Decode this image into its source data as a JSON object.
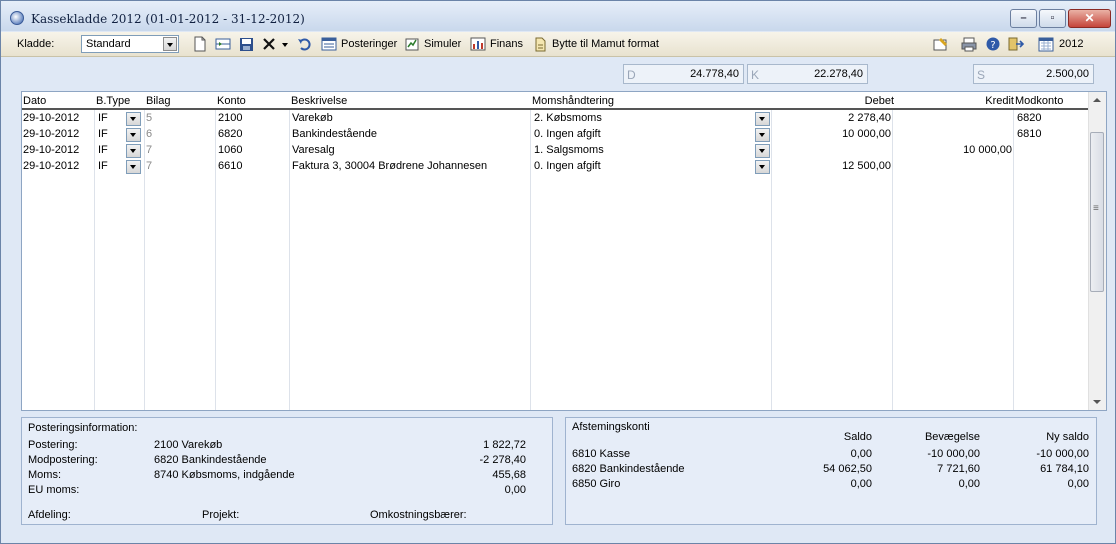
{
  "window": {
    "title": "Kassekladde 2012 (01-01-2012 - 31-12-2012)",
    "minimize": "–",
    "maximize": "▫",
    "close": "✕"
  },
  "toolbar": {
    "kladde_label": "Kladde:",
    "kladde_value": "Standard",
    "posteringer": "Posteringer",
    "simuler": "Simuler",
    "finans": "Finans",
    "bytte": "Bytte til Mamut format",
    "year": "2012"
  },
  "totals": {
    "d_prefix": "D",
    "d_value": "24.778,40",
    "k_prefix": "K",
    "k_value": "22.278,40",
    "s_prefix": "S",
    "s_value": "2.500,00"
  },
  "grid": {
    "columns": [
      "Dato",
      "B.Type",
      "Bilag",
      "Konto",
      "Beskrivelse",
      "Momshåndtering",
      "Debet",
      "Kredit",
      "Modkonto"
    ],
    "rows": [
      {
        "dato": "29-10-2012",
        "btype": "IF",
        "bilag": "5",
        "konto": "2100",
        "beskrivelse": "Varekøb",
        "moms": "2. Købsmoms",
        "debet": "2 278,40",
        "kredit": "",
        "modkonto": "6820"
      },
      {
        "dato": "29-10-2012",
        "btype": "IF",
        "bilag": "6",
        "konto": "6820",
        "beskrivelse": "Bankindestående",
        "moms": "0. Ingen afgift",
        "debet": "10 000,00",
        "kredit": "",
        "modkonto": "6810"
      },
      {
        "dato": "29-10-2012",
        "btype": "IF",
        "bilag": "7",
        "konto": "1060",
        "beskrivelse": "Varesalg",
        "moms": "1. Salgsmoms",
        "debet": "",
        "kredit": "10 000,00",
        "modkonto": ""
      },
      {
        "dato": "29-10-2012",
        "btype": "IF",
        "bilag": "7",
        "konto": "6610",
        "beskrivelse": "Faktura 3, 30004 Brødrene Johannesen",
        "moms": "0. Ingen afgift",
        "debet": "12 500,00",
        "kredit": "",
        "modkonto": ""
      }
    ]
  },
  "info": {
    "title": "Posteringsinformation:",
    "postering_label": "Postering:",
    "postering_text": "2100 Varekøb",
    "postering_value": "1 822,72",
    "modpostering_label": "Modpostering:",
    "modpostering_text": "6820 Bankindestående",
    "modpostering_value": "-2 278,40",
    "moms_label": "Moms:",
    "moms_text": "8740 Købsmoms, indgående",
    "moms_value": "455,68",
    "eu_label": "EU moms:",
    "eu_value": "0,00",
    "afdeling": "Afdeling:",
    "projekt": "Projekt:",
    "omkostning": "Omkostningsbærer:"
  },
  "afstemning": {
    "title": "Afstemingskonti",
    "headers": [
      "Saldo",
      "Bevægelse",
      "Ny saldo"
    ],
    "rows": [
      {
        "konto": "6810 Kasse",
        "saldo": "0,00",
        "bev": "-10 000,00",
        "ny": "-10 000,00"
      },
      {
        "konto": "6820 Bankindestående",
        "saldo": "54 062,50",
        "bev": "7 721,60",
        "ny": "61 784,10"
      },
      {
        "konto": "6850 Giro",
        "saldo": "0,00",
        "bev": "0,00",
        "ny": "0,00"
      }
    ]
  }
}
